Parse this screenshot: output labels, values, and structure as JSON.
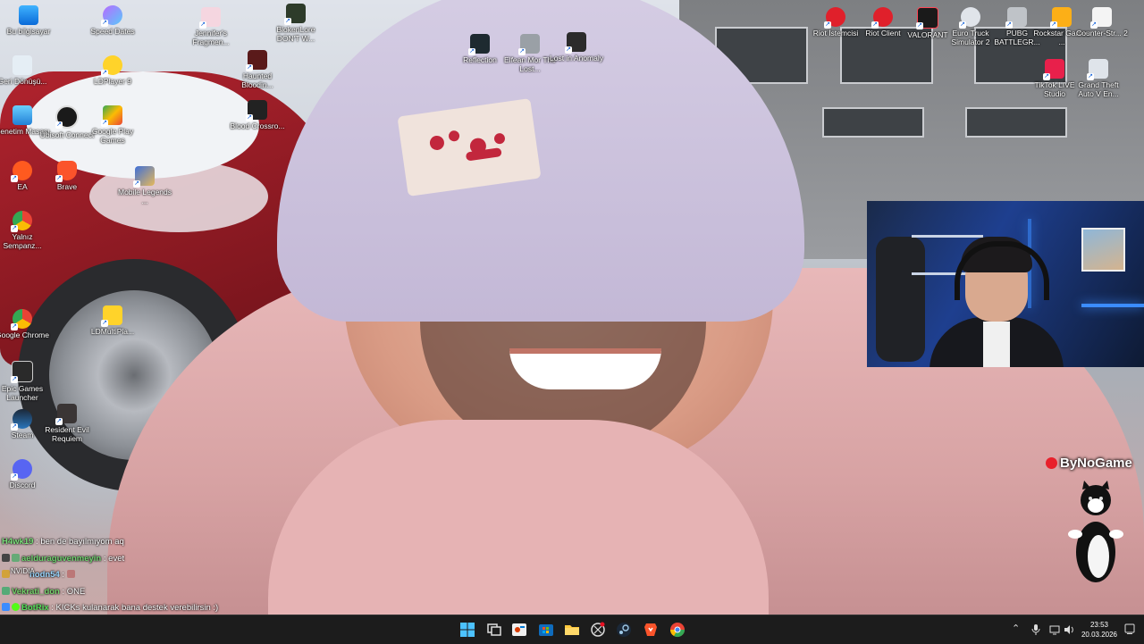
{
  "desktop": {
    "icons_left": [
      {
        "label": "Bu bilgisayar"
      },
      {
        "label": "Speed Dates"
      },
      {
        "label": "Jennifer's Fragmen..."
      },
      {
        "label": "BlokenLore DON'T W..."
      },
      {
        "label": "Geri Dönüşü..."
      },
      {
        "label": "LDPlayer 9"
      },
      {
        "label": "Haunted Bloodin..."
      },
      {
        "label": "Denetim Masası"
      },
      {
        "label": "Ubisoft Connect"
      },
      {
        "label": "Google Play Games"
      },
      {
        "label": "Blood Crossro..."
      },
      {
        "label": "EA"
      },
      {
        "label": "Brave"
      },
      {
        "label": "Mobile Legends ..."
      },
      {
        "label": "Yalnız Sempanz..."
      },
      {
        "label": "Google Chrome"
      },
      {
        "label": "LDMultiPla..."
      },
      {
        "label": "Epic Games Launcher"
      },
      {
        "label": "Steam"
      },
      {
        "label": "Resident Evil Requiem"
      },
      {
        "label": "Discord"
      },
      {
        "label": "Reflection"
      },
      {
        "label": "Elfean Mor The Lost..."
      },
      {
        "label": "Lost in Anomaly"
      }
    ],
    "icons_right": [
      {
        "label": "Riot İstemcisi"
      },
      {
        "label": "Riot Client"
      },
      {
        "label": "VALORANT"
      },
      {
        "label": "Euro Truck Simulator 2"
      },
      {
        "label": "PUBG BATTLEGR..."
      },
      {
        "label": "Rockstar Games ..."
      },
      {
        "label": "Counter-Str... 2"
      },
      {
        "label": "TikTok LIVE Studio"
      },
      {
        "label": "Grand Theft Auto V En..."
      }
    ],
    "nvidia_label": "NVIDIA"
  },
  "overlay": {
    "brand": "ByNoGame"
  },
  "chat": [
    {
      "user": "H4wk19",
      "message": "ben de bayılmıyom aq",
      "user_color": "#7be07b"
    },
    {
      "user": "aelduraguvenmeyin",
      "message": "evet",
      "user_color": "#6fd36f"
    },
    {
      "user": "hodn54",
      "message": "",
      "user_color": "#9ad7ff"
    },
    {
      "user": "Vekrati_don",
      "message": "ONE",
      "user_color": "#74d36a"
    },
    {
      "user": "BotRix",
      "message": "KICKs kulanarak bana destek verebilirsin :)",
      "user_color": "#55e05a"
    }
  ],
  "clock": {
    "time": "23:53",
    "date": "20.03.2026"
  },
  "colors": {
    "taskbar": "#1c1c1c",
    "brand_red": "#e8202b"
  }
}
